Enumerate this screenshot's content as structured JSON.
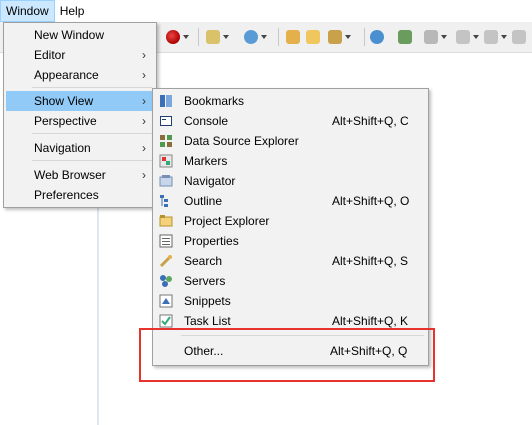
{
  "menubar": {
    "window_label": "Window",
    "help_label": "Help"
  },
  "window_menu": {
    "items": [
      {
        "label": "New Window",
        "submenu": false
      },
      {
        "label": "Editor",
        "submenu": true
      },
      {
        "label": "Appearance",
        "submenu": true
      },
      {
        "label": "Show View",
        "submenu": true
      },
      {
        "label": "Perspective",
        "submenu": true
      },
      {
        "label": "Navigation",
        "submenu": true
      },
      {
        "label": "Web Browser",
        "submenu": true
      },
      {
        "label": "Preferences",
        "submenu": false
      }
    ],
    "chevron": "›"
  },
  "show_view_menu": {
    "items": [
      {
        "label": "Bookmarks",
        "shortcut": "",
        "icon": "bookmarks-icon"
      },
      {
        "label": "Console",
        "shortcut": "Alt+Shift+Q, C",
        "icon": "console-icon"
      },
      {
        "label": "Data Source Explorer",
        "shortcut": "",
        "icon": "data-source-icon"
      },
      {
        "label": "Markers",
        "shortcut": "",
        "icon": "markers-icon"
      },
      {
        "label": "Navigator",
        "shortcut": "",
        "icon": "navigator-icon"
      },
      {
        "label": "Outline",
        "shortcut": "Alt+Shift+Q, O",
        "icon": "outline-icon"
      },
      {
        "label": "Project Explorer",
        "shortcut": "",
        "icon": "project-explorer-icon"
      },
      {
        "label": "Properties",
        "shortcut": "",
        "icon": "properties-icon"
      },
      {
        "label": "Search",
        "shortcut": "Alt+Shift+Q, S",
        "icon": "search-icon"
      },
      {
        "label": "Servers",
        "shortcut": "",
        "icon": "servers-icon"
      },
      {
        "label": "Snippets",
        "shortcut": "",
        "icon": "snippets-icon"
      },
      {
        "label": "Task List",
        "shortcut": "Alt+Shift+Q, K",
        "icon": "task-list-icon"
      }
    ],
    "other": {
      "label": "Other...",
      "shortcut": "Alt+Shift+Q, Q"
    }
  },
  "colors": {
    "highlight": "#91c9f7",
    "menu_bg": "#f2f2f2",
    "annotation_red": "#e8322e"
  }
}
